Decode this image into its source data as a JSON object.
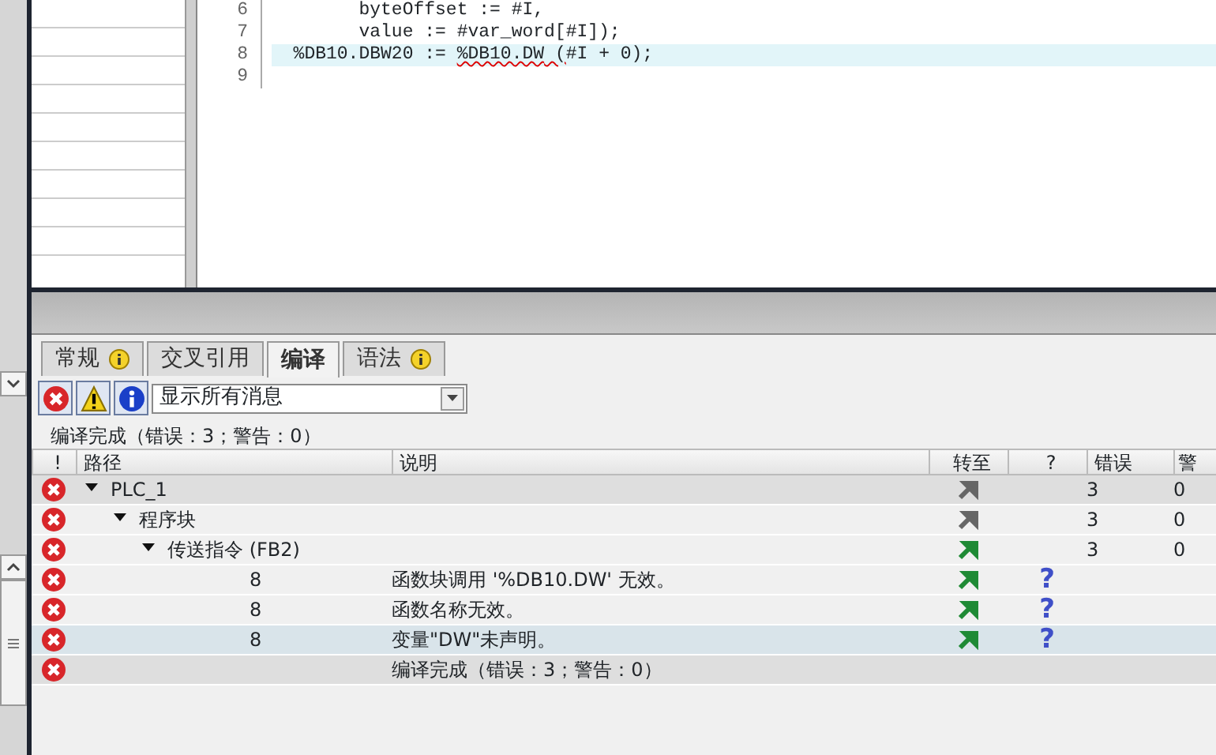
{
  "editor": {
    "lines": [
      {
        "number": "6",
        "current": false,
        "segments": [
          {
            "text": "        byteOffset := #I,"
          }
        ]
      },
      {
        "number": "7",
        "current": false,
        "segments": [
          {
            "text": "        value := #var_word[#I]);"
          }
        ]
      },
      {
        "number": "8",
        "current": true,
        "segments": [
          {
            "text": "  %DB10.DBW20 := "
          },
          {
            "text": "%DB10.DW",
            "error": true
          },
          {
            "text": " (",
            "error": true
          },
          {
            "text": "#I + 0);"
          }
        ]
      },
      {
        "number": "9",
        "current": false
      }
    ]
  },
  "tabs": [
    {
      "label": "常规",
      "info": true,
      "selected": false
    },
    {
      "label": "交叉引用",
      "info": false,
      "selected": false
    },
    {
      "label": "编译",
      "info": false,
      "selected": true
    },
    {
      "label": "语法",
      "info": true,
      "selected": false
    }
  ],
  "filters": [
    {
      "kind": "error",
      "on": true
    },
    {
      "kind": "warning",
      "on": true
    },
    {
      "kind": "info",
      "on": true
    }
  ],
  "message_filter": {
    "value": "显示所有消息"
  },
  "summary": "编译完成（错误：3；警告：0）",
  "table": {
    "columns": [
      "!",
      "路径",
      "说明",
      "转至",
      "?",
      "错误",
      "警"
    ],
    "rows": [
      {
        "kind": "error",
        "path": "PLC_1",
        "expanded": true,
        "goto": {
          "color": "#666666"
        },
        "errors": "3",
        "warnings": "0",
        "selected": false,
        "highlighted": true,
        "children": [
          {
            "kind": "error",
            "path": "程序块",
            "expanded": true,
            "goto": {
              "color": "#666666"
            },
            "errors": "3",
            "warnings": "0",
            "selected": false,
            "highlighted": false,
            "children": [
              {
                "kind": "error",
                "path": "传送指令 (FB2)",
                "expanded": true,
                "goto": {
                  "color": "#1f8a35"
                },
                "errors": "3",
                "warnings": "0",
                "selected": false,
                "highlighted": false,
                "children": [
                  {
                    "kind": "error",
                    "path": "8",
                    "description": "函数块调用 '%DB10.DW' 无效。",
                    "goto": {
                      "color": "#1f8a35"
                    },
                    "help": "?",
                    "selected": false,
                    "highlighted": false
                  },
                  {
                    "kind": "error",
                    "path": "8",
                    "description": "函数名称无效。",
                    "goto": {
                      "color": "#1f8a35"
                    },
                    "help": "?",
                    "selected": false,
                    "highlighted": false
                  },
                  {
                    "kind": "error",
                    "path": "8",
                    "description": "变量\"DW\"未声明。",
                    "goto": {
                      "color": "#1f8a35"
                    },
                    "help": "?",
                    "selected": true,
                    "highlighted": false
                  }
                ]
              }
            ]
          }
        ]
      },
      {
        "kind": "error",
        "description": "编译完成（错误：3；警告：0）",
        "selected": false,
        "highlighted": true
      }
    ]
  }
}
